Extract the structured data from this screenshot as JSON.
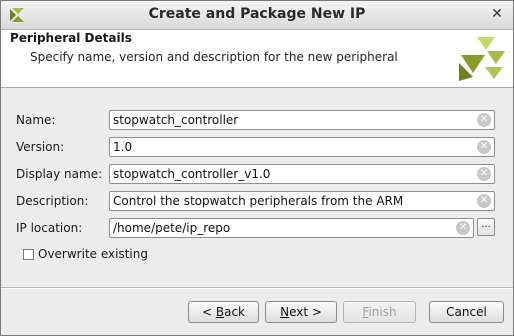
{
  "window": {
    "title": "Create and Package New IP",
    "close_glyph": "✕",
    "app_icon": "vivado-logo-icon"
  },
  "header": {
    "title": "Peripheral Details",
    "description": "Specify name, version and description for the new peripheral",
    "logo_icon": "xilinx-logo-icon"
  },
  "form": {
    "name": {
      "label": "Name:",
      "value": "stopwatch_controller"
    },
    "version": {
      "label": "Version:",
      "value": "1.0"
    },
    "display_name": {
      "label": "Display name:",
      "value": "stopwatch_controller_v1.0"
    },
    "description": {
      "label": "Description:",
      "value": "Control the stopwatch peripherals from the ARM"
    },
    "ip_location": {
      "label": "IP location:",
      "value": "/home/pete/ip_repo",
      "browse_label": "..."
    },
    "overwrite": {
      "label": "Overwrite existing",
      "checked": false
    }
  },
  "buttons": {
    "back": {
      "label_prefix": "< ",
      "mnemonic": "B",
      "label_rest": "ack"
    },
    "next": {
      "mnemonic": "N",
      "label_rest": "ext >"
    },
    "finish": {
      "mnemonic": "F",
      "label_rest": "inish"
    },
    "cancel": {
      "label": "Cancel"
    }
  },
  "colors": {
    "logo_dark": "#8a9a2c",
    "logo_light": "#c8d66a"
  }
}
